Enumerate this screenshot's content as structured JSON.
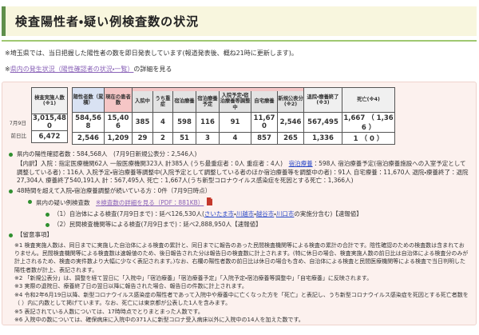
{
  "colors": {
    "accent_green": "#5f8f4b",
    "rule_green": "#9fc871",
    "panel_pink": "#fcf1ee",
    "header_pink": "#f5c6c6",
    "header_blue": "#d9e2f3",
    "bullet_green": "#2f8f2f",
    "link_purple": "#8a63b8",
    "link_blue": "#2b49c8"
  },
  "header": {
    "title": "検査陽性者・疑い例検査数の状況"
  },
  "intro": {
    "line1": "※埼玉県では、当日把握した陽性者の数を即日発表しています(報道発表後、概ね21時に更新します)。",
    "line2_prefix": "※",
    "line2_link": "県内の発生状況（陽性確認者の状況・一覧）",
    "line2_suffix": "の詳細を見る"
  },
  "table": {
    "headers": {
      "tested": "検査実施人数(※1)",
      "positive": "陽性者数（累積）",
      "current": "現在の患者数",
      "hospitalized": "入院中",
      "severe": "うち重症",
      "hotel": "宿泊療養",
      "hotel_planned": "宿泊療養予定",
      "adjusting": "入院予定・宿泊療養等調整中",
      "home": "自宅療養",
      "new_published": "新規公表分(※2)",
      "recovered": "退院・療養終了(※3)",
      "deaths": "死亡(※4)"
    },
    "rows": [
      {
        "label": "7月9日",
        "tested": "3,015,480",
        "positive": "584,568",
        "current": "15,406",
        "hospitalized": "385",
        "severe": "4",
        "hotel": "598",
        "hotel_planned": "116",
        "adjusting": "91",
        "home": "11,670",
        "new_published": "2,546",
        "recovered": "567,495",
        "deaths": "1,667 （ 1,366 ）"
      },
      {
        "label": "前日比",
        "tested": "6,472",
        "positive": "2,546",
        "current": "1,209",
        "hospitalized": "29",
        "severe": "2",
        "hotel": "51",
        "hotel_planned": "3",
        "adjusting": "4",
        "home": "857",
        "new_published": "265",
        "recovered": "1,336",
        "deaths": "1 （ 0 ）"
      }
    ]
  },
  "bullets": {
    "positive_total": "県内の陽性確認者数：584,568人　(7月9日新規公表分：2,546人)",
    "breakdown_pre": "【内訳】入院：指定医療機関62人 一般医療機関323人 計385人 (うち最重症者：0人 重症者：4人)　",
    "breakdown_link": "宿泊療養",
    "breakdown_post": "：598人 宿泊療養予定(宿泊療養施設への入室予定として調整している者)：116人 入院予定・宿泊療養等調整中(入院予定として調整している者のほか宿泊療養等を調整中の者)：91人 自宅療養：11,670人 退院・療養終了：退院27,304人 療養終了540,191人 計：567,495人 死亡：1,667人(うち新型コロナウイルス感染症を死因とする死亡：1,366人)",
    "waiting48h": "48時間を超えて入院・宿泊療養調整が続いている方：0件（7月9日時点）",
    "suspected_label": "県内の疑い例検査数　",
    "suspected_link": "※検査数の詳細を見る（PDF：881KB）",
    "item1_pre": "（1）自治体による検査(7月9日まで)：延べ126,530人(",
    "city1": "さいたま市",
    "city2": "川越市",
    "city3": "越谷市",
    "city4": "川口市",
    "city_sep": "・",
    "item1_post": "の実施分含む)【速報値】",
    "item2": "（2）民間検査機関等による検査(7月9日まで)：延べ2,888,950人【速報値】"
  },
  "notes": {
    "title": "【留意事項】",
    "items": [
      "※1 検査実施人数は、同日までに実施した自治体による検査の累計と、同日までに報告のあった民間検査機関等による検査の累計の合計です。陰性確認のための検査数は含まれておりません。民間検査機関等による検査数は速報値のため、後日報告された分は報告日の検査数に計上されます。(特に休日の場合、検査実施人数の前日比は自治体による検査分のみが計上されるため、検査の実件数より大幅に少なく表記されます。)なお、右欄の陽性者数の前日比は休日の場合も含め、自治体による検査と民間医療機関等による検査で当日判明した陽性者数が計上、表記されます。",
      "※2 「新規公表分」は、調整を経て翌日に「入院中」「宿泊療養」「宿泊療養予定」「入院予定・宿泊療養等調整中」「自宅療養」に反映されます。",
      "※3 実際の退院日、療養終了日の翌日以降に報告された場合、報告日の件数に計上されます。",
      "※4 令和2年6月19日以降、新型コロナウイルス感染症の陽性者であって入院中や療養中に亡くなった方を「死亡」と表記し、うち新型コロナウイルス感染症を死因とする死亡者数を（ ）内に内数として掲げています。なお、死亡には東京都が公表した1人を含みます。",
      "※5 表記されている人数については、17時時点でとりまとまった人数です。",
      "※6 入院中の数については、確保病床に入院中の371人に新型コロナ受入病床以外に入院中の14人を加えた数です。"
    ]
  }
}
